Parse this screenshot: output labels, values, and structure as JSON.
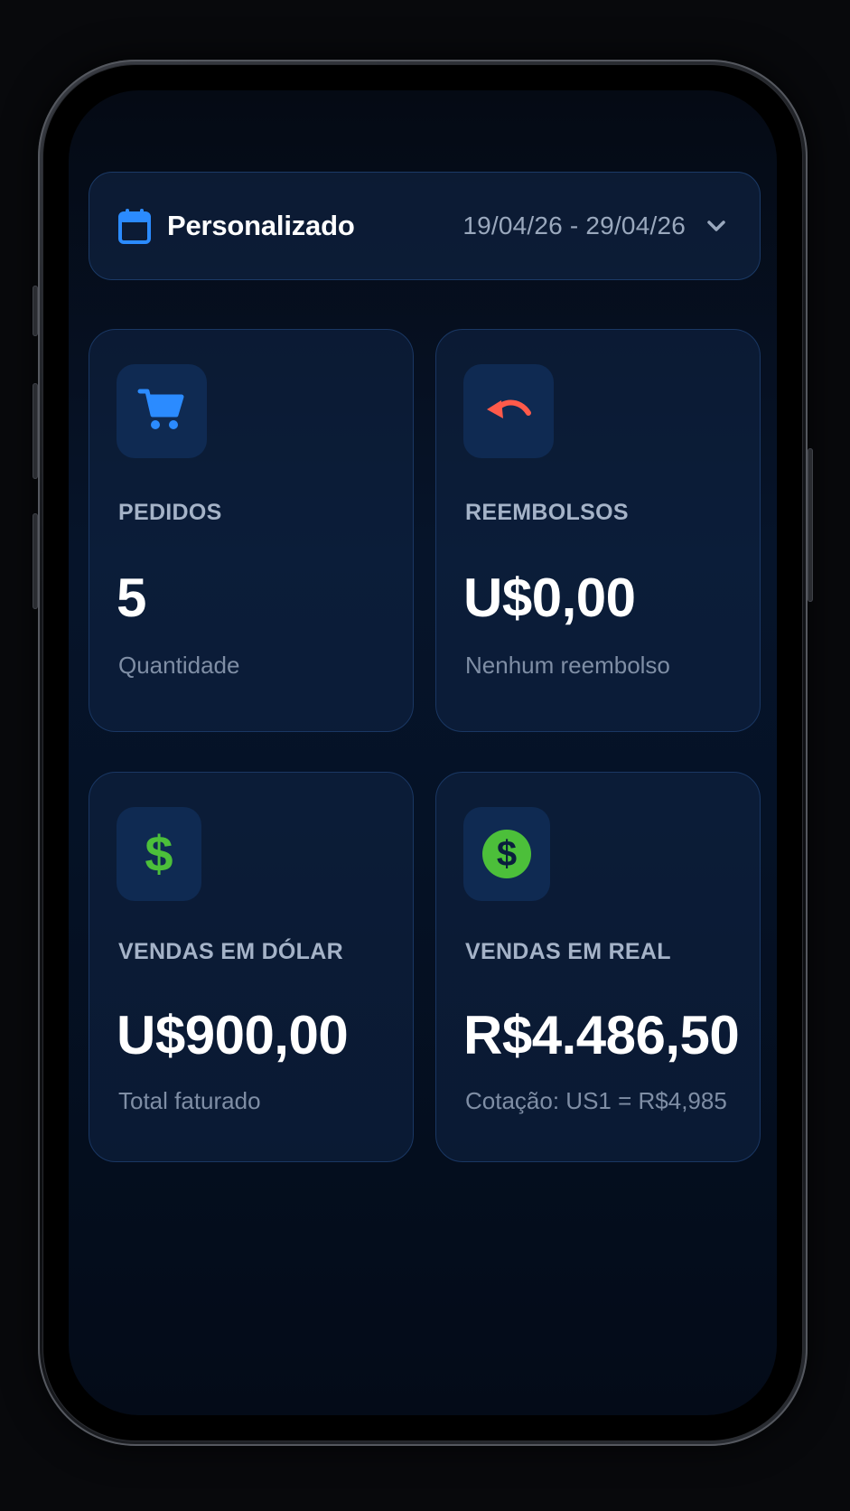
{
  "period": {
    "label": "Personalizado",
    "range": "19/04/26 - 29/04/26"
  },
  "cards": [
    {
      "title": "PEDIDOS",
      "value": "5",
      "subtitle": "Quantidade",
      "icon": "cart-icon",
      "icon_color": "#2b8bff"
    },
    {
      "title": "REEMBOLSOS",
      "value": "U$0,00",
      "subtitle": "Nenhum reembolso",
      "icon": "undo-icon",
      "icon_color": "#ff5a4a"
    },
    {
      "title": "VENDAS EM DÓLAR",
      "value": "U$900,00",
      "subtitle": "Total faturado",
      "icon": "dollar-icon",
      "icon_color": "#4cbf3a"
    },
    {
      "title": "VENDAS EM REAL",
      "value": "R$4.486,50",
      "subtitle": "Cotação: US1 = R$4,985",
      "icon": "dollar-coin-icon",
      "icon_color": "#4cbf3a"
    }
  ],
  "colors": {
    "accent_blue": "#2b8bff",
    "refund_red": "#ff5a4a",
    "money_green": "#4cbf3a"
  }
}
